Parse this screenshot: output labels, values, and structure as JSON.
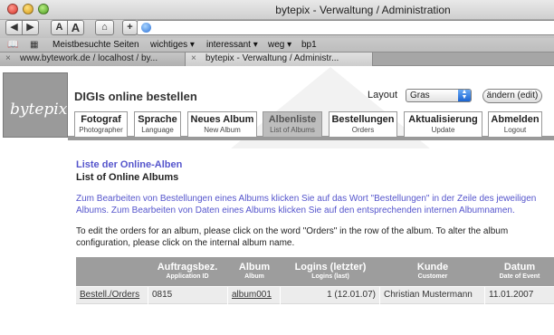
{
  "browser": {
    "window_title": "bytepix - Verwaltung / Administration",
    "buttons": {
      "back": "◀",
      "forward": "▶",
      "font_smaller": "A",
      "font_larger": "A",
      "home": "⌂",
      "add": "+"
    },
    "bookmarks": [
      "Meistbesuchte Seiten",
      "wichtiges ▾",
      "interessant ▾",
      "weg ▾",
      "bp1"
    ],
    "tabs": [
      "www.bytework.de / localhost / by...",
      "bytepix - Verwaltung / Administr..."
    ],
    "tab_close": "×"
  },
  "page": {
    "logo": "bytepix",
    "heading": "DIGIs online bestellen",
    "layout_label": "Layout",
    "layout_value": "Gras",
    "change_button": "ändern (edit)",
    "nav": [
      {
        "en": "Fotograf",
        "de": "Photographer",
        "active": false
      },
      {
        "en": "Sprache",
        "de": "Language",
        "active": false
      },
      {
        "en": "Neues Album",
        "de": "New Album",
        "active": false
      },
      {
        "en": "Albenliste",
        "de": "List of Albums",
        "active": true
      },
      {
        "en": "Bestellungen",
        "de": "Orders",
        "active": false
      },
      {
        "en": "Aktualisierung",
        "de": "Update",
        "active": false
      },
      {
        "en": "Abmelden",
        "de": "Logout",
        "active": false
      }
    ],
    "title_de": "Liste der Online-Alben",
    "title_en": "List of Online Albums",
    "desc_de": "Zum Bearbeiten von Bestellungen eines Albums klicken Sie auf das Wort \"Bestellungen\" in der Zeile des jeweiligen Albums. Zum Bearbeiten von Daten eines Albums klicken Sie auf den entsprechenden internen Albumnamen.",
    "desc_en": "To edit the orders for an album, please click on the word \"Orders\" in the row of the album. To alter the album configuration, please click on the internal album name.",
    "table": {
      "columns": [
        {
          "title": "",
          "sub": ""
        },
        {
          "title": "Auftragsbez.",
          "sub": "Application ID"
        },
        {
          "title": "Album",
          "sub": "Album"
        },
        {
          "title": "Logins (letzter)",
          "sub": "Logins (last)"
        },
        {
          "title": "Kunde",
          "sub": "Customer"
        },
        {
          "title": "Datum",
          "sub": "Date of Event"
        }
      ],
      "rows": [
        [
          "Bestell./Orders",
          "0815",
          "album001",
          "1 (12.01.07)",
          "Christian Mustermann",
          "11.01.2007"
        ]
      ]
    }
  }
}
